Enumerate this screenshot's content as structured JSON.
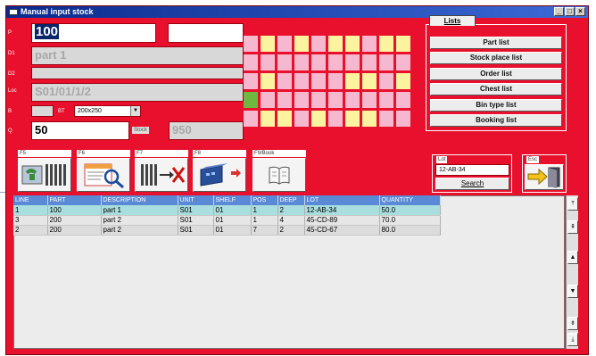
{
  "window": {
    "title": "Manual input stock",
    "controls": [
      "_",
      "□",
      "×"
    ]
  },
  "form": {
    "part_label": "P",
    "part_value": "100",
    "part_extra": "",
    "description_label": "D1",
    "description_value": "part 1",
    "description2_label": "D2",
    "description2_value": "",
    "location_label": "Loc",
    "location_value": "S01/01/1/2",
    "box_label": "B",
    "box_value": "",
    "box_type_label": "BT",
    "box_type_value": "200x250",
    "quantity_label": "Q",
    "quantity_value": "50",
    "stock_label": "Stock",
    "stock_value": "950"
  },
  "grid": [
    [
      "p",
      "y",
      "p",
      "y",
      "p",
      "y",
      "y",
      "p",
      "y",
      "y"
    ],
    [
      "p",
      "p",
      "p",
      "p",
      "p",
      "p",
      "p",
      "p",
      "p",
      "p"
    ],
    [
      "p",
      "y",
      "p",
      "p",
      "p",
      "p",
      "y",
      "y",
      "p",
      "y"
    ],
    [
      "g",
      "p",
      "p",
      "p",
      "p",
      "p",
      "p",
      "p",
      "p",
      "p"
    ],
    [
      "p",
      "y",
      "y",
      "p",
      "y",
      "p",
      "y",
      "y",
      "p",
      "p"
    ]
  ],
  "lists": {
    "tab_label": "Lists",
    "items": [
      "Part list",
      "Stock place list",
      "Order list",
      "Chest list",
      "Bin type list",
      "Booking list"
    ]
  },
  "function_keys": [
    {
      "key": "F5",
      "icon": "phone-rack-icon"
    },
    {
      "key": "F6",
      "icon": "search-document-icon"
    },
    {
      "key": "F7",
      "icon": "rack-delete-icon"
    },
    {
      "key": "F8",
      "icon": "transfer-icon"
    },
    {
      "key": "F9/Book",
      "icon": "book-icon"
    }
  ],
  "lot": {
    "label": "Lot",
    "value": "12-AB-34",
    "search_label": "Search"
  },
  "exit": {
    "label": "Esc",
    "icon": "exit-door-icon"
  },
  "table": {
    "columns": [
      "LINE",
      "PART",
      "DESCRIPTION",
      "UNIT",
      "SHELF",
      "POS",
      "DEEP",
      "LOT",
      "QUANTITY"
    ],
    "rows": [
      [
        "1",
        "100",
        "part 1",
        "S01",
        "01",
        "1",
        "2",
        "12-AB-34",
        "50.0"
      ],
      [
        "3",
        "200",
        "part 2",
        "S01",
        "01",
        "1",
        "4",
        "45-CD-89",
        "70.0"
      ],
      [
        "2",
        "200",
        "part 2",
        "S01",
        "01",
        "7",
        "2",
        "45-CD-67",
        "80.0"
      ]
    ]
  },
  "scrollbar": {
    "buttons": [
      "⤒",
      "⇞",
      "▲",
      "▼",
      "⇟",
      "⤓"
    ]
  }
}
